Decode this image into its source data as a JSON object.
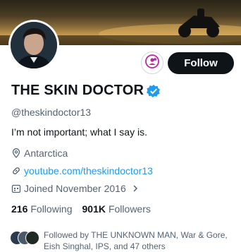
{
  "profile": {
    "name": "THE SKIN DOCTOR",
    "handle": "@theskindoctor13",
    "bio": "I’m not important; what I say is.",
    "location": "Antarctica",
    "website": "youtube.com/theskindoctor13",
    "joined": "Joined November 2016",
    "verified": true
  },
  "actions": {
    "follow_label": "Follow"
  },
  "stats": {
    "following_count": "216",
    "following_label": "Following",
    "followers_count": "901K",
    "followers_label": "Followers"
  },
  "followed_by": {
    "text": "Followed by THE UNKNOWN MAN, War & Gore, Eish Singhal, IPS, and 47 others"
  },
  "colors": {
    "accent": "#1d9bf0",
    "subscribe": "#c026a8",
    "button": "#0f1419"
  },
  "icons": [
    "location-icon",
    "link-icon",
    "calendar-icon",
    "chevron-right-icon",
    "verified-icon",
    "subscribe-icon"
  ]
}
